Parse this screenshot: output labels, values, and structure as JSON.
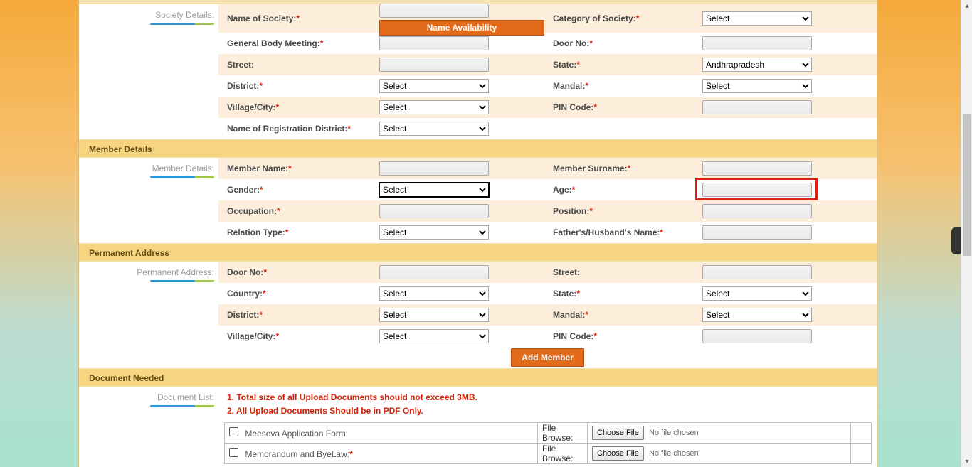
{
  "top_section": {
    "left_label": "Society Details:",
    "fields": {
      "nameOfSociety": "Name of  Society:",
      "nameAvailability_btn": "Name Availability",
      "categoryOfSociety": "Category of Society:",
      "categorySelect": "Select",
      "generalBodyMeeting": "General Body Meeting:",
      "doorNo": "Door No:",
      "street": "Street:",
      "state": "State:",
      "stateSelect": "Andhrapradesh",
      "district": "District:",
      "districtSelect": "Select",
      "mandal": "Mandal:",
      "mandalSelect": "Select",
      "villageCity": "Village/City:",
      "villageSelect": "Select",
      "pinCode": "PIN Code:",
      "regDistrict": "Name of Registration District:",
      "regDistrictSelect": "Select"
    }
  },
  "member_section": {
    "title": "Member Details",
    "left_label": "Member Details:",
    "fields": {
      "memberName": "Member Name:",
      "memberSurname": "Member Surname:",
      "gender": "Gender:",
      "genderSelect": "Select",
      "age": "Age:",
      "occupation": "Occupation:",
      "position": "Position:",
      "relationType": "Relation Type:",
      "relationSelect": "Select",
      "fatherHusband": "Father's/Husband's Name:"
    }
  },
  "permanent_section": {
    "title": "Permanent Address",
    "left_label": "Permanent Address:",
    "fields": {
      "doorNo": "Door No:",
      "street": "Street:",
      "country": "Country:",
      "countrySelect": "Select",
      "state": "State:",
      "stateSelect": "Select",
      "district": "District:",
      "districtSelect": "Select",
      "mandal": "Mandal:",
      "mandalSelect": "Select",
      "villageCity": "Village/City:",
      "villageSelect": "Select",
      "pinCode": "PIN Code:",
      "addMember_btn": "Add Member"
    }
  },
  "document_section": {
    "title": "Document Needed",
    "left_label": "Document List:",
    "note1": "1. Total size of all Upload Documents should not exceed 3MB.",
    "note2": "2. All Upload Documents Should be in PDF Only.",
    "rows": [
      {
        "label": "Meeseva Application Form:",
        "required": false
      },
      {
        "label": "Memorandum and ByeLaw:",
        "required": true
      }
    ],
    "fileBrowseLabel": "File Browse:",
    "chooseFile_btn": "Choose File",
    "noFile": "No file chosen"
  }
}
